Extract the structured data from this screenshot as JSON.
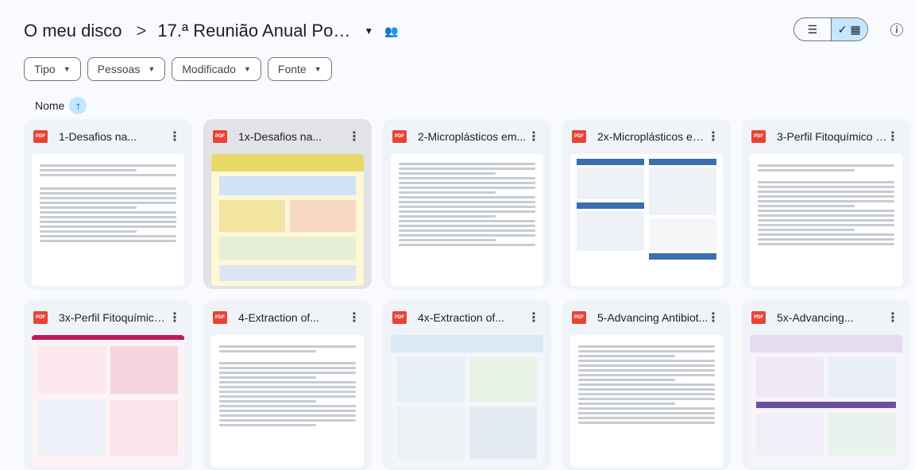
{
  "breadcrumb": {
    "root": "O meu disco",
    "separator": ">",
    "current_folder": "17.ª Reunião Anual PortF..."
  },
  "view_toggle": {
    "list_icon": "list-icon",
    "grid_icon": "grid-icon",
    "active": "grid"
  },
  "filters": [
    {
      "label": "Tipo"
    },
    {
      "label": "Pessoas"
    },
    {
      "label": "Modificado"
    },
    {
      "label": "Fonte"
    }
  ],
  "sort": {
    "label": "Nome",
    "direction_icon": "arrow-up-icon"
  },
  "files": [
    {
      "name": "1-Desafios na...",
      "type": "PDF"
    },
    {
      "name": "1x-Desafios na...",
      "type": "PDF"
    },
    {
      "name": "2-Microplásticos em...",
      "type": "PDF"
    },
    {
      "name": "2x-Microplásticos em...",
      "type": "PDF"
    },
    {
      "name": "3-Perfil Fitoquímico e...",
      "type": "PDF"
    },
    {
      "name": "3x-Perfil Fitoquímico ...",
      "type": "PDF"
    },
    {
      "name": "4-Extraction of...",
      "type": "PDF"
    },
    {
      "name": "4x-Extraction of...",
      "type": "PDF"
    },
    {
      "name": "5-Advancing Antibiot...",
      "type": "PDF"
    },
    {
      "name": "5x-Advancing...",
      "type": "PDF"
    }
  ],
  "colors": {
    "background": "#f8fafd",
    "card": "#f0f4f9",
    "card_selected": "#e1e3e7",
    "accent": "#c2e7ff",
    "pdf_red": "#ea4335"
  }
}
